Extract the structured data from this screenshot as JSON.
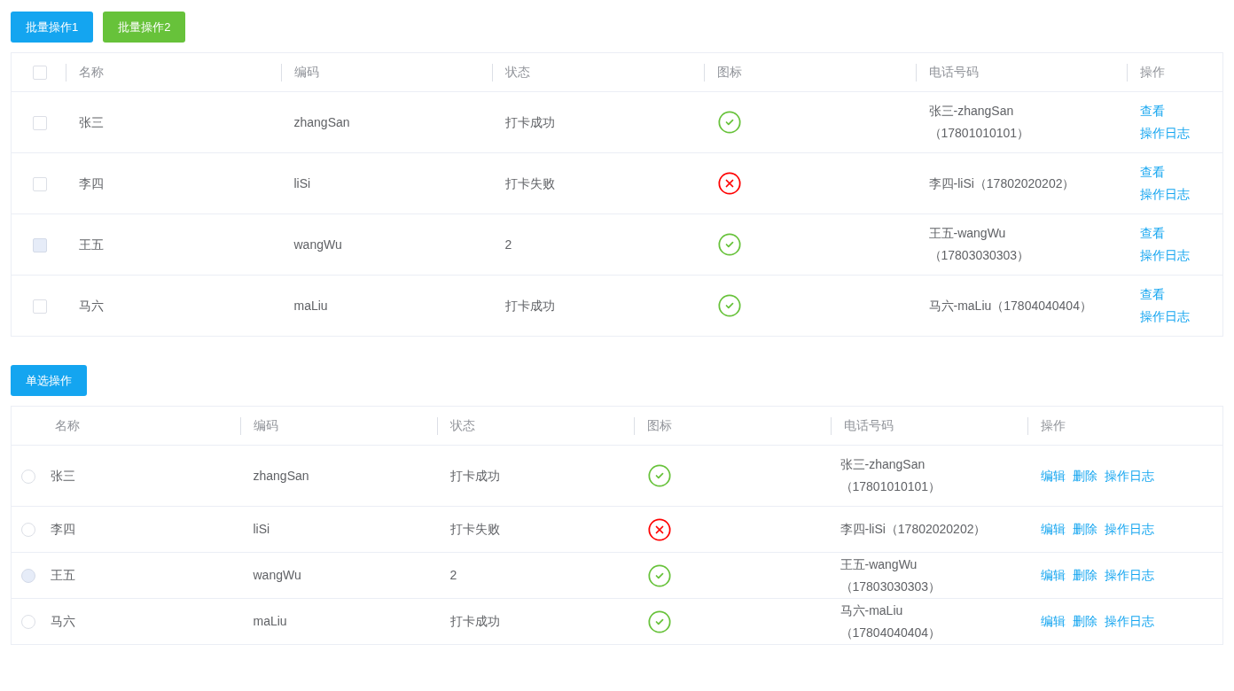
{
  "toolbar_1": {
    "buttons": [
      {
        "label": "批量操作1",
        "kind": "primary"
      },
      {
        "label": "批量操作2",
        "kind": "success"
      }
    ]
  },
  "table_1": {
    "select_all": {
      "checked": false
    },
    "columns": [
      "名称",
      "编码",
      "状态",
      "图标",
      "电话号码",
      "操作"
    ],
    "rows": [
      {
        "checked": false,
        "disabled": false,
        "name": "张三",
        "code": "zhangSan",
        "status": "打卡成功",
        "kind": "success",
        "phone": "张三-zhangSan（17801010101）",
        "actions": [
          "查看",
          "操作日志"
        ]
      },
      {
        "checked": false,
        "disabled": false,
        "name": "李四",
        "code": "liSi",
        "status": "打卡失败",
        "kind": "fail",
        "phone": "李四-liSi（17802020202）",
        "actions": [
          "查看",
          "操作日志"
        ]
      },
      {
        "checked": false,
        "disabled": true,
        "name": "王五",
        "code": "wangWu",
        "status": "2",
        "kind": "success",
        "phone": "王五-wangWu（17803030303）",
        "actions": [
          "查看",
          "操作日志"
        ]
      },
      {
        "checked": false,
        "disabled": false,
        "name": "马六",
        "code": "maLiu",
        "status": "打卡成功",
        "kind": "success",
        "phone": "马六-maLiu（17804040404）",
        "actions": [
          "查看",
          "操作日志"
        ]
      }
    ]
  },
  "toolbar_2": {
    "buttons": [
      {
        "label": "单选操作",
        "kind": "primary"
      }
    ]
  },
  "table_2": {
    "columns": [
      "名称",
      "编码",
      "状态",
      "图标",
      "电话号码",
      "操作"
    ],
    "rows": [
      {
        "selected": false,
        "disabled": false,
        "name": "张三",
        "code": "zhangSan",
        "status": "打卡成功",
        "kind": "success",
        "phone": "张三-zhangSan（17801010101）",
        "actions": [
          "编辑",
          "删除",
          "操作日志"
        ]
      },
      {
        "selected": false,
        "disabled": false,
        "name": "李四",
        "code": "liSi",
        "status": "打卡失败",
        "kind": "fail",
        "phone": "李四-liSi（17802020202）",
        "actions": [
          "编辑",
          "删除",
          "操作日志"
        ]
      },
      {
        "selected": false,
        "disabled": true,
        "name": "王五",
        "code": "wangWu",
        "status": "2",
        "kind": "success",
        "phone": "王五-wangWu（17803030303）",
        "actions": [
          "编辑",
          "删除",
          "操作日志"
        ]
      },
      {
        "selected": false,
        "disabled": false,
        "name": "马六",
        "code": "maLiu",
        "status": "打卡成功",
        "kind": "success",
        "phone": "马六-maLiu（17804040404）",
        "actions": [
          "编辑",
          "删除",
          "操作日志"
        ]
      }
    ]
  }
}
